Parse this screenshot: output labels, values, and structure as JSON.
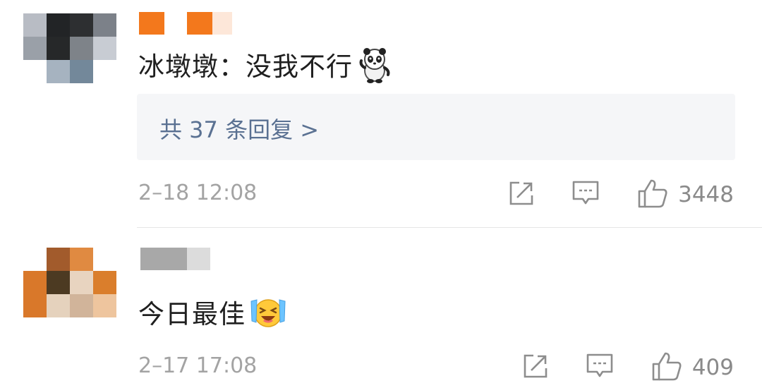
{
  "comments": [
    {
      "text": "冰墩墩：没我不行",
      "emoji": "panda-mascot-icon",
      "reply_link": "共 37 条回复 >",
      "timestamp": "2–18 12:08",
      "likes": "3448"
    },
    {
      "text": "今日最佳",
      "emoji": "laughing-crying-face-icon",
      "timestamp": "2–17 17:08",
      "likes": "409"
    }
  ],
  "colors": {
    "link": "#5a7192",
    "meta": "#a3a3a3",
    "reply_bg": "#f5f6f8",
    "divider": "#e6e6e6"
  }
}
